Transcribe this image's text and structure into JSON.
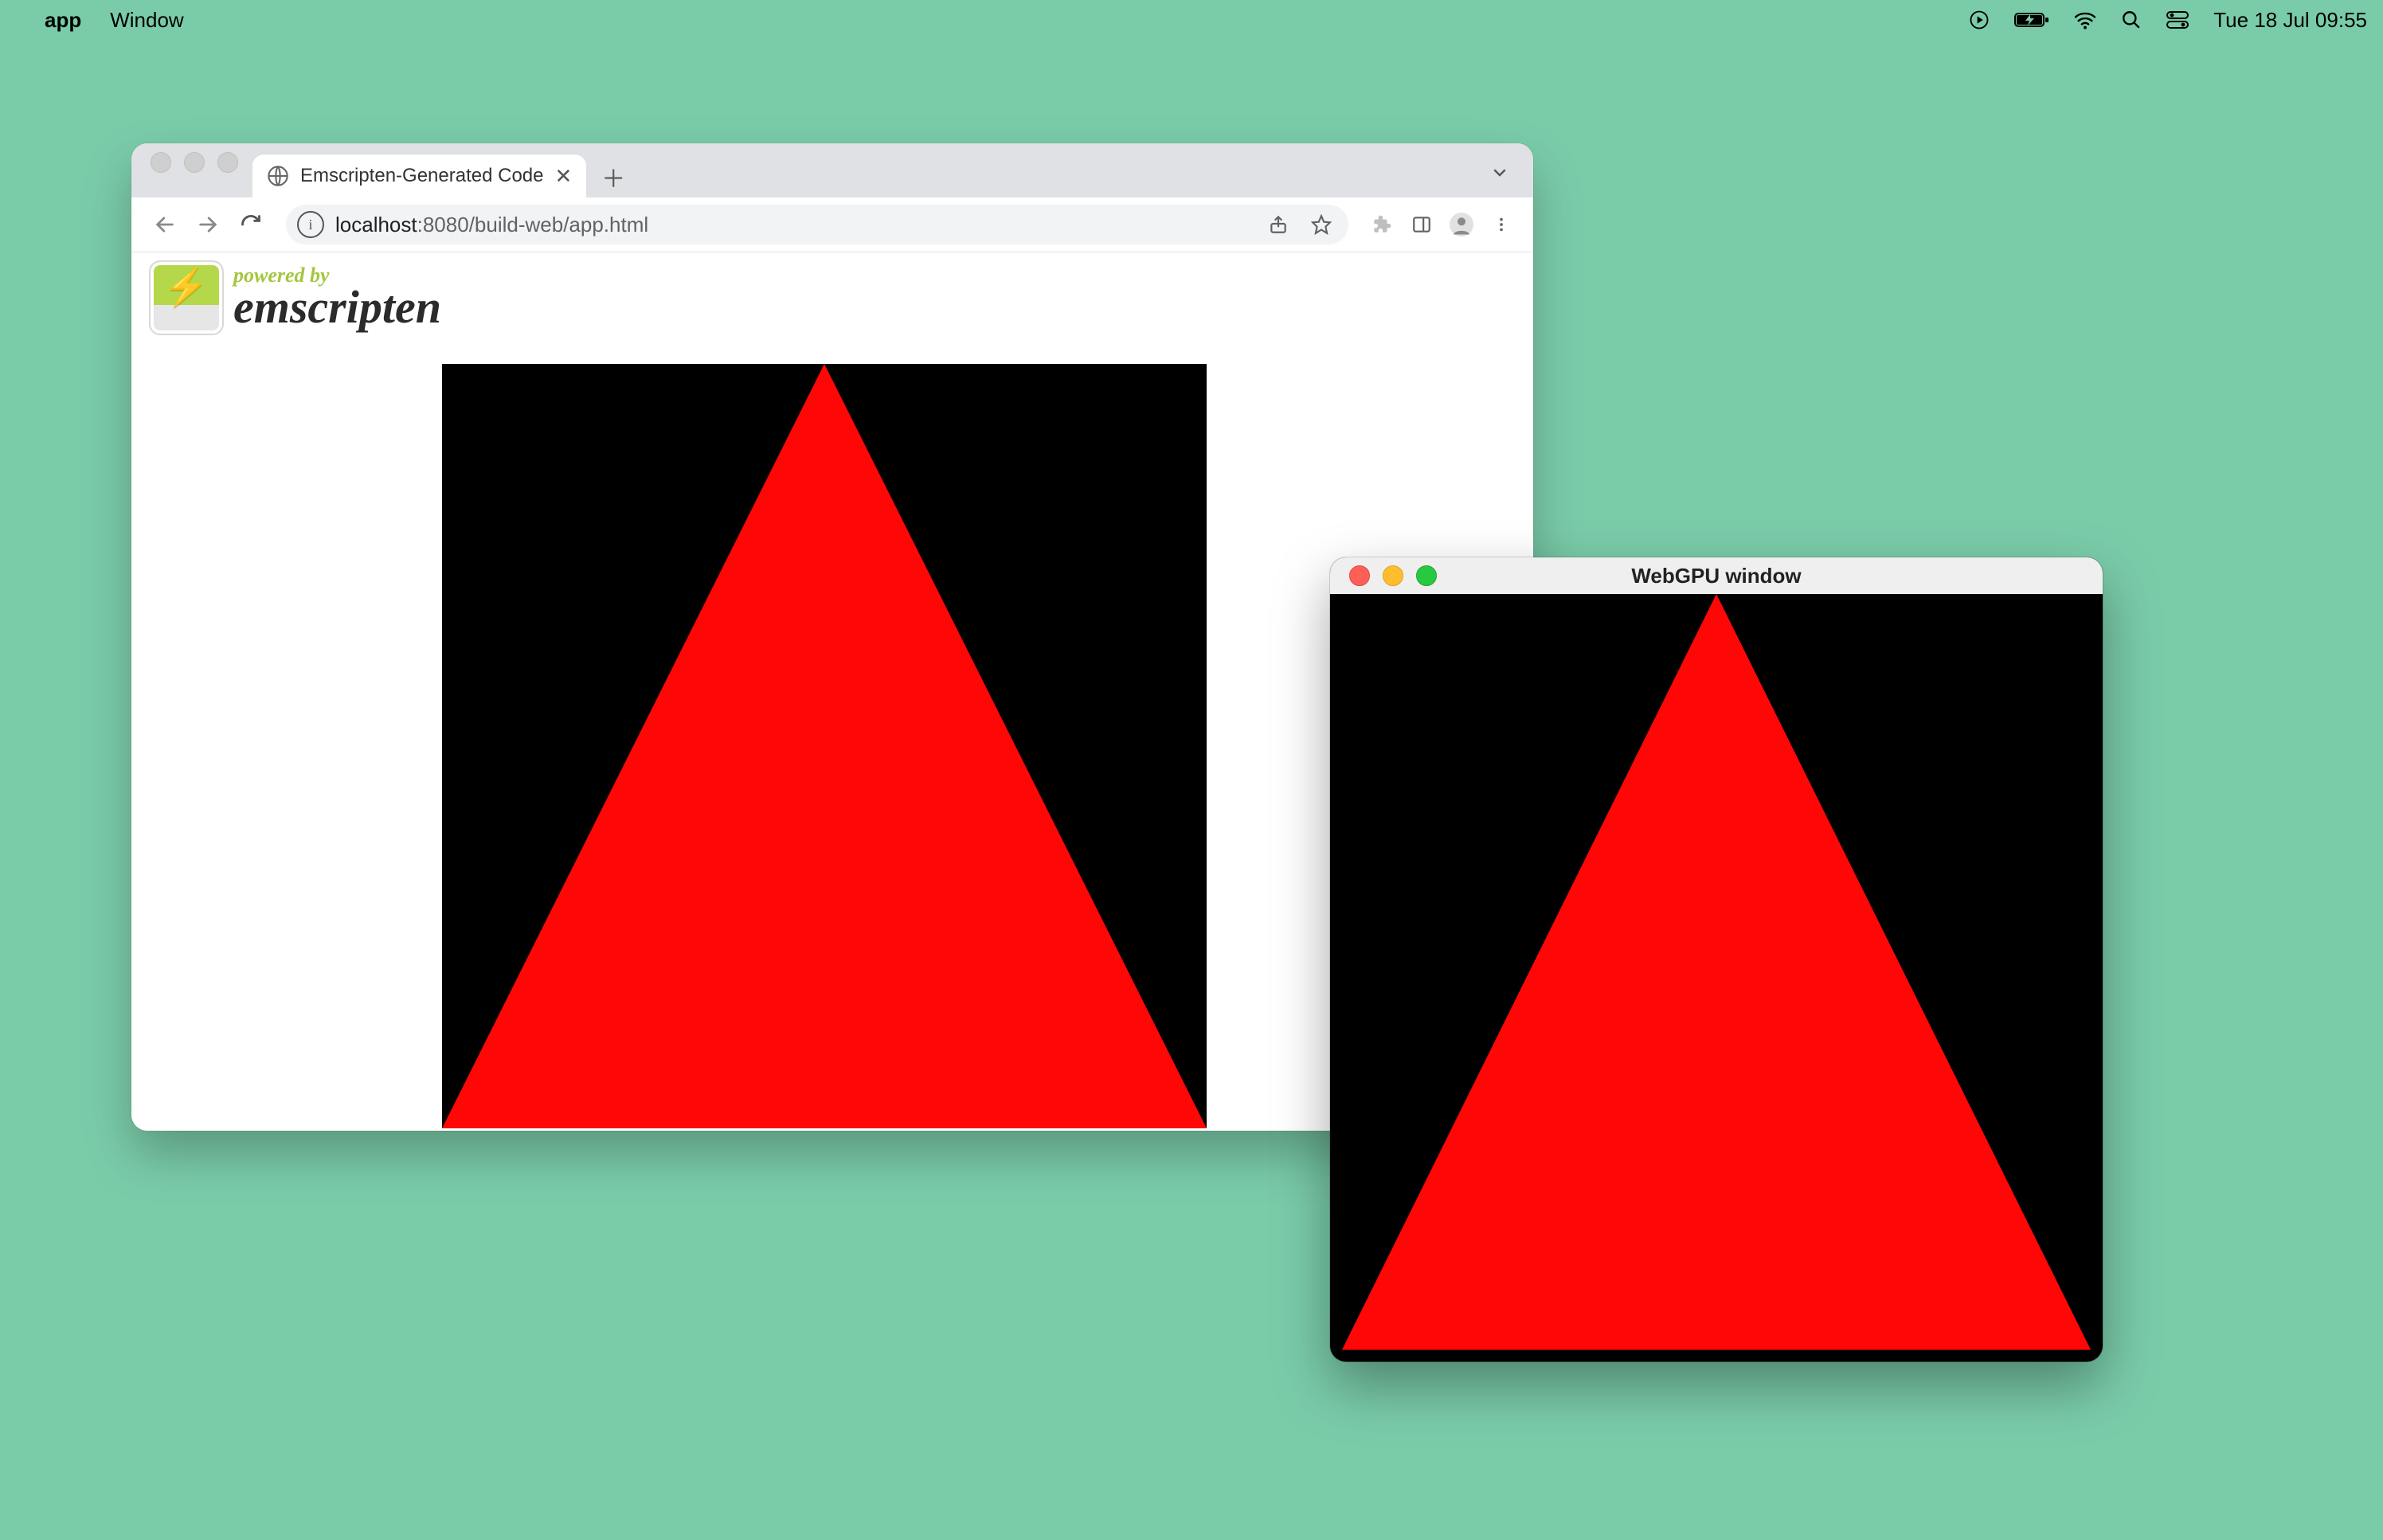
{
  "menubar": {
    "app_name": "app",
    "menus": [
      "Window"
    ],
    "clock": "Tue 18 Jul  09:55"
  },
  "browser": {
    "tab_title": "Emscripten-Generated Code",
    "url_host": "localhost",
    "url_path": ":8080/build-web/app.html",
    "emscripten": {
      "powered_by": "powered by",
      "name": "emscripten"
    }
  },
  "native_window": {
    "title": "WebGPU window"
  },
  "render": {
    "triangle_color": "#ff0707",
    "background_color": "#000000"
  }
}
